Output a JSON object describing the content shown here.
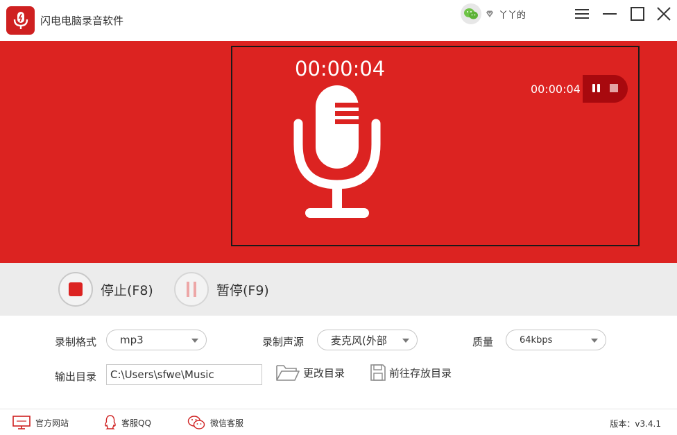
{
  "app": {
    "title": "闪电电脑录音软件"
  },
  "user": {
    "name": "丫丫的"
  },
  "recording": {
    "elapsed_main": "00:00:04",
    "elapsed_float": "00:00:04"
  },
  "controls": {
    "stop_label": "停止(F8)",
    "pause_label": "暂停(F9)"
  },
  "settings": {
    "format_label": "录制格式",
    "format_value": "mp3",
    "source_label": "录制声源",
    "source_value": "麦克风(外部",
    "quality_label": "质量",
    "quality_value": "64kbps",
    "output_label": "输出目录",
    "output_path": "C:\\Users\\sfwe\\Music",
    "change_dir_label": "更改目录",
    "open_dir_label": "前往存放目录"
  },
  "footer": {
    "website": "官方网站",
    "qq": "客服QQ",
    "wechat": "微信客服",
    "version": "版本：v3.4.1"
  },
  "colors": {
    "brand_red": "#dc2321",
    "dark_red": "#a8090e",
    "control_bg": "#ececec"
  }
}
